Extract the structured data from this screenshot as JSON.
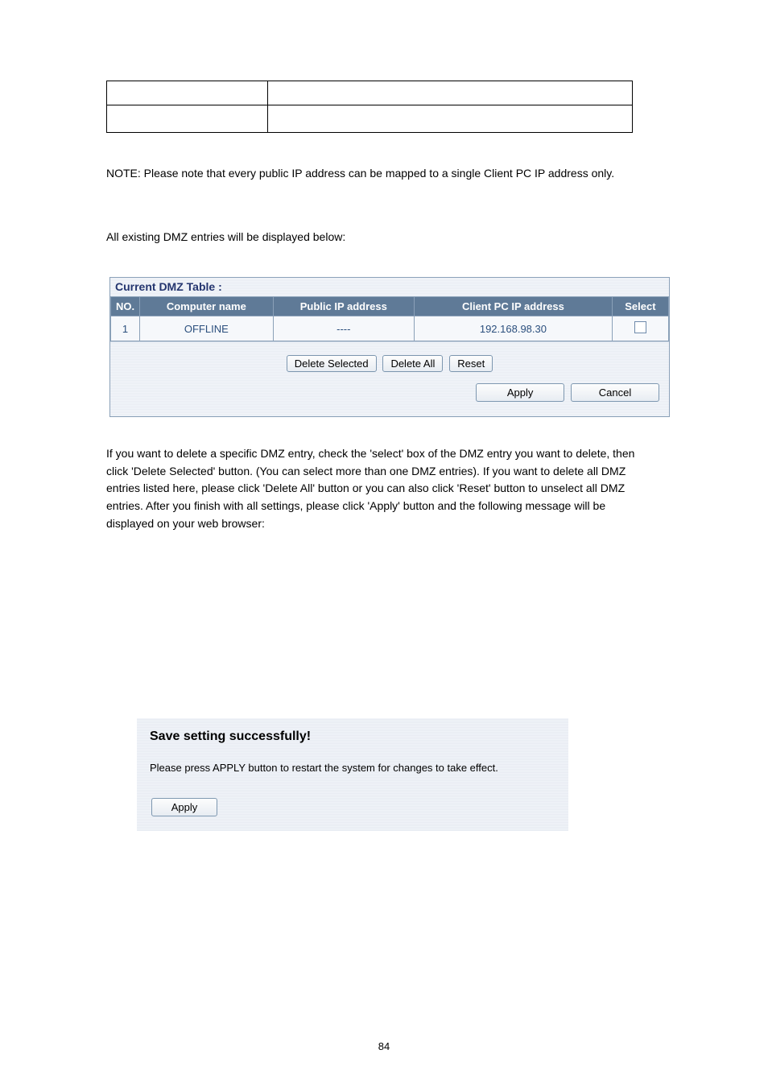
{
  "top_table": {
    "rows": [
      {
        "col1": "",
        "col2": ""
      },
      {
        "col1": "",
        "col2": ""
      }
    ]
  },
  "body_text": {
    "para1": "NOTE: Please note that every public IP address can be mapped to a single Client PC IP address only.",
    "para2": "All existing DMZ entries will be displayed below:",
    "para3": "If you want to delete a specific DMZ entry, check the 'select' box of the DMZ entry you want to delete, then click 'Delete Selected' button. (You can select more than one DMZ entries). If you want to delete all DMZ entries listed here, please click 'Delete All' button or you can also click 'Reset' button to unselect all DMZ entries. After you finish with all settings, please click 'Apply' button and the following message will be displayed on your web browser:",
    "para4": ""
  },
  "dmz": {
    "title": "Current DMZ Table :",
    "headers": {
      "no": "NO.",
      "name": "Computer name",
      "pub": "Public IP address",
      "cli": "Client PC IP address",
      "sel": "Select"
    },
    "rows": [
      {
        "no": "1",
        "name": "OFFLINE",
        "pub": "----",
        "cli": "192.168.98.30",
        "sel": false
      }
    ],
    "buttons": {
      "delete_selected": "Delete Selected",
      "delete_all": "Delete All",
      "reset": "Reset",
      "apply": "Apply",
      "cancel": "Cancel"
    }
  },
  "save": {
    "title": "Save setting successfully!",
    "message": "Please press APPLY button to restart the system for changes to take effect.",
    "apply": "Apply"
  },
  "footer": {
    "page": "84"
  }
}
